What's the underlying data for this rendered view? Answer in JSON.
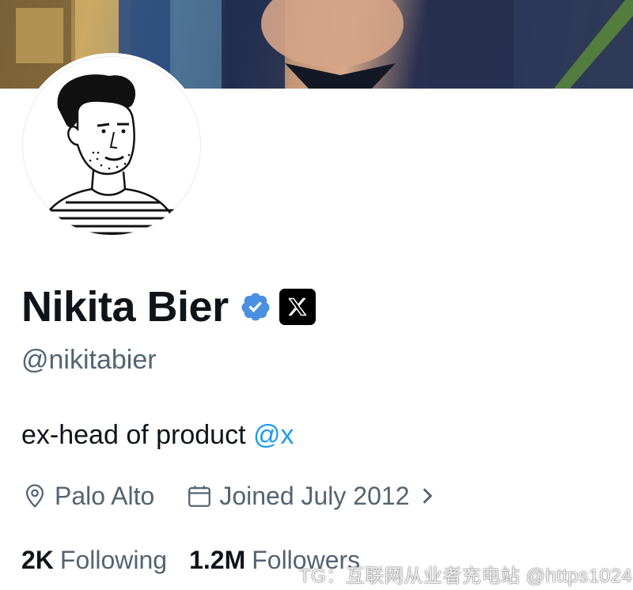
{
  "profile": {
    "display_name": "Nikita Bier",
    "handle": "@nikitabier",
    "bio_text": "ex-head of product ",
    "bio_mention": "@x",
    "location": "Palo Alto",
    "joined": "Joined July 2012"
  },
  "stats": {
    "following_count": "2K",
    "following_label": "Following",
    "followers_count": "1.2M",
    "followers_label": "Followers"
  },
  "badges": {
    "verified_icon": "verified-badge-icon",
    "affiliation_icon": "x-logo-icon"
  },
  "colors": {
    "accent": "#1d9bf0",
    "secondary_text": "#536471",
    "primary_text": "#0f1419",
    "verified": "#1d9bf0"
  },
  "watermark": "TG：互联网从业者充电站 @https1024"
}
